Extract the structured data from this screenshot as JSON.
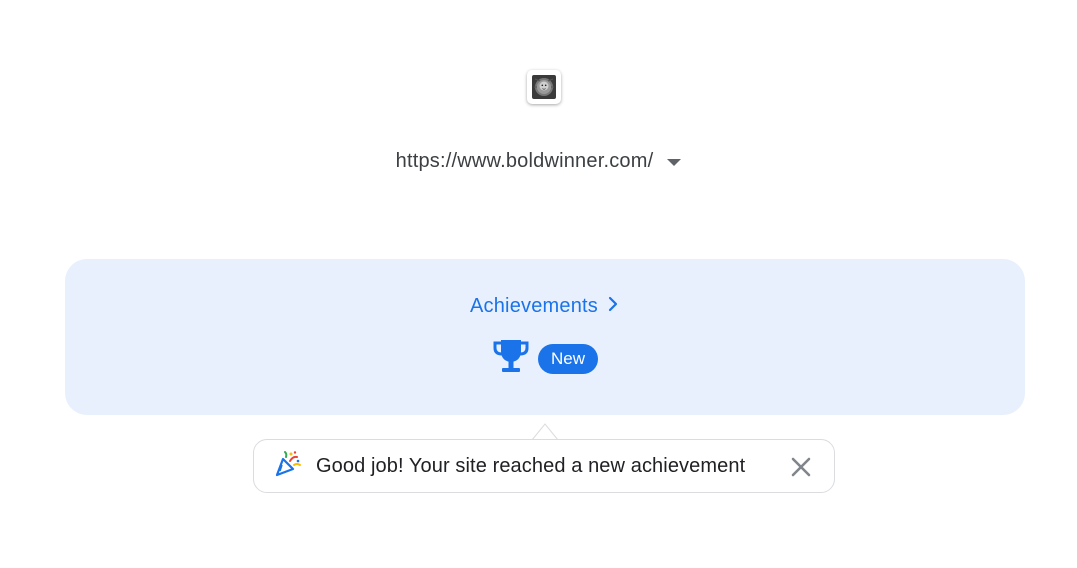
{
  "site": {
    "favicon_icon": "lion-favicon-icon",
    "url": "https://www.boldwinner.com/",
    "dropdown_icon": "caret-down-icon"
  },
  "achievements_card": {
    "title": "Achievements",
    "chevron_icon": "chevron-right-icon",
    "trophy_icon": "trophy-icon",
    "badge_label": "New",
    "background_color": "#e8f0fe",
    "accent_color": "#1a73e8"
  },
  "tooltip": {
    "icon": "party-popper-icon",
    "message": "Good job! Your site reached a new achievement",
    "close_icon": "close-icon"
  }
}
